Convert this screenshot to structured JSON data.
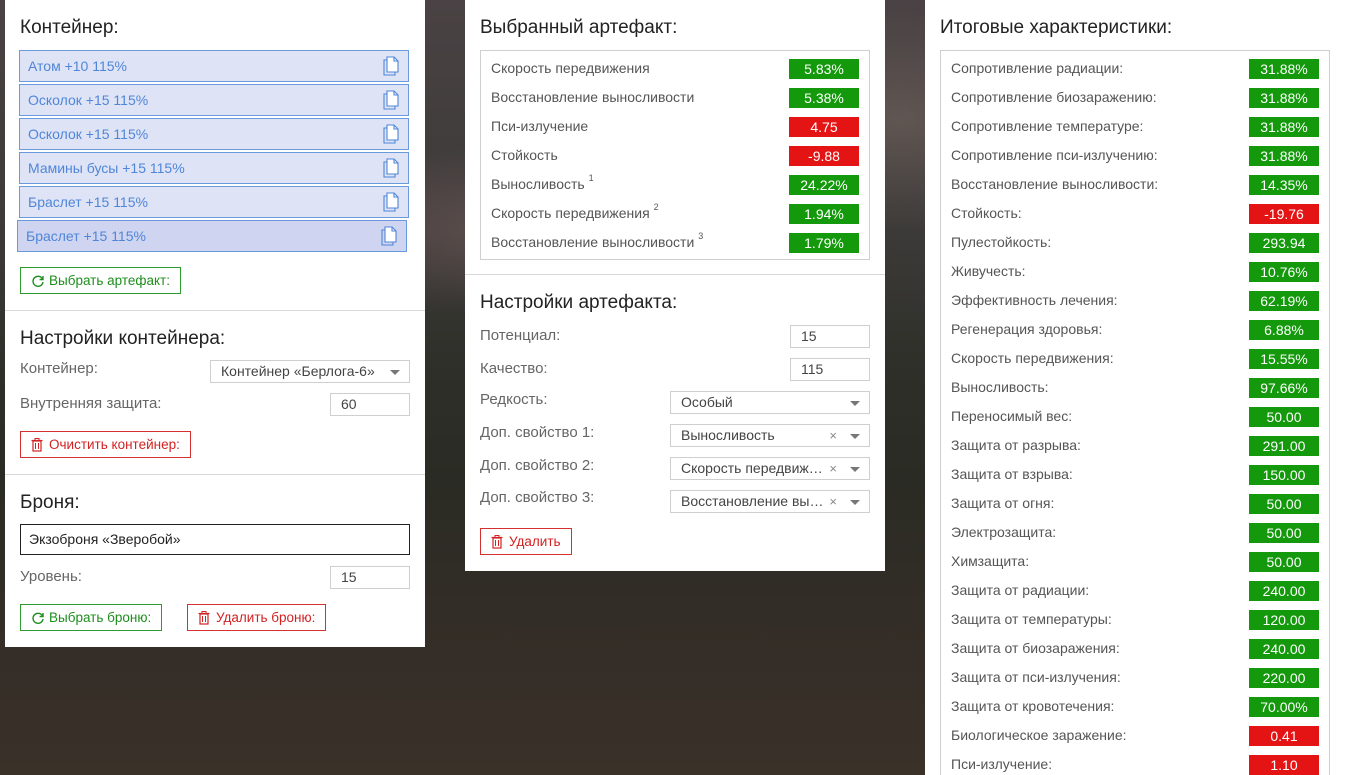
{
  "container_panel": {
    "title": "Контейнер:",
    "items": [
      {
        "label": "Атом +10 115%"
      },
      {
        "label": "Осколок +15 115%"
      },
      {
        "label": "Осколок +15 115%"
      },
      {
        "label": "Мамины бусы +15 115%"
      },
      {
        "label": "Браслет +15 115%"
      },
      {
        "label": "Браслет +15 115%"
      }
    ],
    "select_artifact_button": "Выбрать артефакт:",
    "settings_title": "Настройки контейнера:",
    "container_label": "Контейнер:",
    "container_value": "Контейнер «Берлога-6»",
    "inner_protection_label": "Внутренняя защита:",
    "inner_protection_value": "60",
    "clear_button": "Очистить контейнер:",
    "armor_title": "Броня:",
    "armor_value": "Экзоброня «Зверобой»",
    "level_label": "Уровень:",
    "level_value": "15",
    "select_armor_button": "Выбрать броню:",
    "delete_armor_button": "Удалить броню:"
  },
  "artifact_panel": {
    "title": "Выбранный артефакт:",
    "stats": [
      {
        "name": "Скорость передвижения",
        "sup": "",
        "value": "5.83%",
        "positive": true
      },
      {
        "name": "Восстановление выносливости",
        "sup": "",
        "value": "5.38%",
        "positive": true
      },
      {
        "name": "Пси-излучение",
        "sup": "",
        "value": "4.75",
        "positive": false
      },
      {
        "name": "Стойкость",
        "sup": "",
        "value": "-9.88",
        "positive": false
      },
      {
        "name": "Выносливость",
        "sup": "1",
        "value": "24.22%",
        "positive": true
      },
      {
        "name": "Скорость передвижения",
        "sup": "2",
        "value": "1.94%",
        "positive": true
      },
      {
        "name": "Восстановление выносливости",
        "sup": "3",
        "value": "1.79%",
        "positive": true
      }
    ],
    "settings_title": "Настройки артефакта:",
    "potential_label": "Потенциал:",
    "potential_value": "15",
    "quality_label": "Качество:",
    "quality_value": "115",
    "rarity_label": "Редкость:",
    "rarity_value": "Особый",
    "prop1_label": "Доп. свойство 1:",
    "prop1_value": "Выносливость",
    "prop2_label": "Доп. свойство 2:",
    "prop2_value": "Скорость передвижения",
    "prop3_label": "Доп. свойство 3:",
    "prop3_value": "Восстановление выносливости",
    "delete_button": "Удалить"
  },
  "summary_panel": {
    "title": "Итоговые характеристики:",
    "stats": [
      {
        "name": "Сопротивление радиации:",
        "value": "31.88%",
        "positive": true
      },
      {
        "name": "Сопротивление биозаражению:",
        "value": "31.88%",
        "positive": true
      },
      {
        "name": "Сопротивление температуре:",
        "value": "31.88%",
        "positive": true
      },
      {
        "name": "Сопротивление пси-излучению:",
        "value": "31.88%",
        "positive": true
      },
      {
        "name": "Восстановление выносливости:",
        "value": "14.35%",
        "positive": true
      },
      {
        "name": "Стойкость:",
        "value": "-19.76",
        "positive": false
      },
      {
        "name": "Пулестойкость:",
        "value": "293.94",
        "positive": true
      },
      {
        "name": "Живучесть:",
        "value": "10.76%",
        "positive": true
      },
      {
        "name": "Эффективность лечения:",
        "value": "62.19%",
        "positive": true
      },
      {
        "name": "Регенерация здоровья:",
        "value": "6.88%",
        "positive": true
      },
      {
        "name": "Скорость передвижения:",
        "value": "15.55%",
        "positive": true
      },
      {
        "name": "Выносливость:",
        "value": "97.66%",
        "positive": true
      },
      {
        "name": "Переносимый вес:",
        "value": "50.00",
        "positive": true
      },
      {
        "name": "Защита от разрыва:",
        "value": "291.00",
        "positive": true
      },
      {
        "name": "Защита от взрыва:",
        "value": "150.00",
        "positive": true
      },
      {
        "name": "Защита от огня:",
        "value": "50.00",
        "positive": true
      },
      {
        "name": "Электрозащита:",
        "value": "50.00",
        "positive": true
      },
      {
        "name": "Химзащита:",
        "value": "50.00",
        "positive": true
      },
      {
        "name": "Защита от радиации:",
        "value": "240.00",
        "positive": true
      },
      {
        "name": "Защита от температуры:",
        "value": "120.00",
        "positive": true
      },
      {
        "name": "Защита от биозаражения:",
        "value": "240.00",
        "positive": true
      },
      {
        "name": "Защита от пси-излучения:",
        "value": "220.00",
        "positive": true
      },
      {
        "name": "Защита от кровотечения:",
        "value": "70.00%",
        "positive": true
      },
      {
        "name": "Биологическое заражение:",
        "value": "0.41",
        "positive": false
      },
      {
        "name": "Пси-излучение:",
        "value": "1.10",
        "positive": false
      }
    ]
  },
  "colors": {
    "positive": "#13990b",
    "negative": "#e51414",
    "accent_blue": "#4f86d8"
  }
}
